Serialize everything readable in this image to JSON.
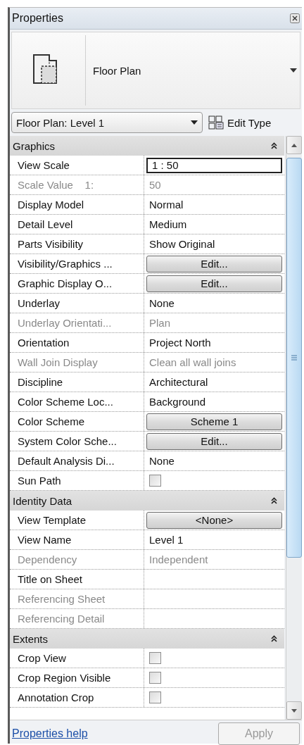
{
  "window": {
    "title": "Properties"
  },
  "type_selector": {
    "name": "Floor Plan"
  },
  "instance_selector": {
    "value": "Floor Plan: Level 1",
    "edit_type": "Edit Type"
  },
  "sections": [
    {
      "title": "Graphics",
      "expanded": true,
      "rows": [
        {
          "label": "View Scale",
          "kind": "field",
          "value": "1 : 50",
          "disabled": false
        },
        {
          "label": "Scale Value    1:",
          "kind": "text",
          "value": "50",
          "disabled": true
        },
        {
          "label": "Display Model",
          "kind": "text",
          "value": "Normal",
          "disabled": false
        },
        {
          "label": "Detail Level",
          "kind": "text",
          "value": "Medium",
          "disabled": false
        },
        {
          "label": "Parts Visibility",
          "kind": "text",
          "value": "Show Original",
          "disabled": false
        },
        {
          "label": "Visibility/Graphics ...",
          "kind": "button",
          "value": "Edit...",
          "disabled": false
        },
        {
          "label": "Graphic Display O...",
          "kind": "button",
          "value": "Edit...",
          "disabled": false
        },
        {
          "label": "Underlay",
          "kind": "text",
          "value": "None",
          "disabled": false
        },
        {
          "label": "Underlay Orientati...",
          "kind": "text",
          "value": "Plan",
          "disabled": true
        },
        {
          "label": "Orientation",
          "kind": "text",
          "value": "Project North",
          "disabled": false
        },
        {
          "label": "Wall Join Display",
          "kind": "text",
          "value": "Clean all wall joins",
          "disabled": true
        },
        {
          "label": "Discipline",
          "kind": "text",
          "value": "Architectural",
          "disabled": false
        },
        {
          "label": "Color Scheme Loc...",
          "kind": "text",
          "value": "Background",
          "disabled": false
        },
        {
          "label": "Color Scheme",
          "kind": "button",
          "value": "Scheme 1",
          "disabled": false
        },
        {
          "label": "System Color Sche...",
          "kind": "button",
          "value": "Edit...",
          "disabled": false
        },
        {
          "label": "Default Analysis Di...",
          "kind": "text",
          "value": "None",
          "disabled": false
        },
        {
          "label": "Sun Path",
          "kind": "checkbox",
          "checked": false,
          "disabled": false
        }
      ]
    },
    {
      "title": "Identity Data",
      "expanded": true,
      "rows": [
        {
          "label": "View Template",
          "kind": "button",
          "value": "<None>",
          "disabled": false
        },
        {
          "label": "View Name",
          "kind": "text",
          "value": "Level 1",
          "disabled": false
        },
        {
          "label": "Dependency",
          "kind": "text",
          "value": "Independent",
          "disabled": true
        },
        {
          "label": "Title on Sheet",
          "kind": "empty",
          "disabled": false
        },
        {
          "label": "Referencing Sheet",
          "kind": "empty",
          "disabled": true
        },
        {
          "label": "Referencing Detail",
          "kind": "empty",
          "disabled": true
        }
      ]
    },
    {
      "title": "Extents",
      "expanded": true,
      "rows": [
        {
          "label": "Crop View",
          "kind": "checkbox",
          "checked": false,
          "disabled": false
        },
        {
          "label": "Crop Region Visible",
          "kind": "checkbox",
          "checked": false,
          "disabled": false
        },
        {
          "label": "Annotation Crop",
          "kind": "checkbox",
          "checked": false,
          "disabled": false
        }
      ]
    }
  ],
  "footer": {
    "help_link": "Properties help",
    "apply": {
      "label": "Apply",
      "disabled": true
    }
  }
}
